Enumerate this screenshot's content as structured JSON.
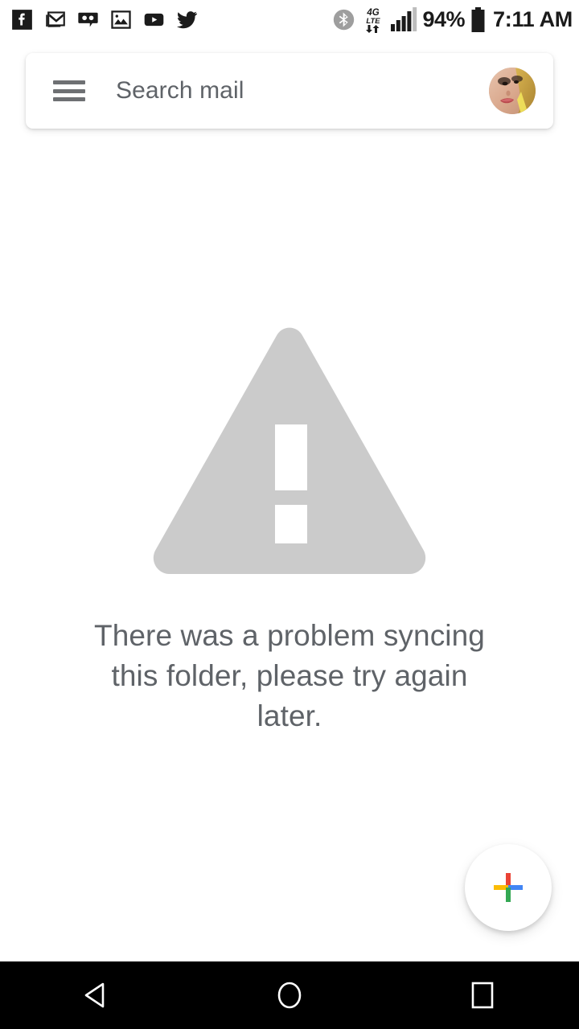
{
  "app": {
    "name": "Gmail",
    "background_color": "#ffffff"
  },
  "status_bar": {
    "time": "7:11 AM",
    "battery_percent": "94%",
    "network_type": "4G",
    "network_sub": "LTE",
    "signal_bars_filled": 4,
    "signal_bars_total": 5,
    "left_icons": [
      {
        "name": "facebook-icon",
        "label": "Facebook"
      },
      {
        "name": "gmail-icon",
        "label": "Gmail"
      },
      {
        "name": "voicemail-icon",
        "label": "Voicemail"
      },
      {
        "name": "screenshot-icon",
        "label": "Screenshot"
      },
      {
        "name": "youtube-icon",
        "label": "YouTube"
      },
      {
        "name": "twitter-icon",
        "label": "Twitter"
      }
    ],
    "right_icons": [
      {
        "name": "bluetooth-icon",
        "label": "Bluetooth"
      },
      {
        "name": "mobile-data-icon",
        "label": "4G LTE"
      },
      {
        "name": "signal-icon",
        "label": "Signal"
      },
      {
        "name": "battery-icon",
        "label": "Battery"
      }
    ]
  },
  "search": {
    "placeholder": "Search mail",
    "menu_label": "Open navigation drawer",
    "avatar_label": "Account profile photo"
  },
  "empty_state": {
    "icon": "warning-triangle-icon",
    "icon_color": "#cbcbcb",
    "message": "There was a problem syncing this folder, please try again later.",
    "message_color": "#5f6368"
  },
  "fab": {
    "label": "Compose",
    "icon": "plus-icon",
    "colors": {
      "top": "#ea4335",
      "right": "#4285f4",
      "bottom": "#34a853",
      "left": "#fbbc05"
    }
  },
  "nav_bar": {
    "background": "#000000",
    "buttons": [
      {
        "name": "back-button",
        "label": "Back"
      },
      {
        "name": "home-button",
        "label": "Home"
      },
      {
        "name": "recents-button",
        "label": "Recent apps"
      }
    ]
  }
}
